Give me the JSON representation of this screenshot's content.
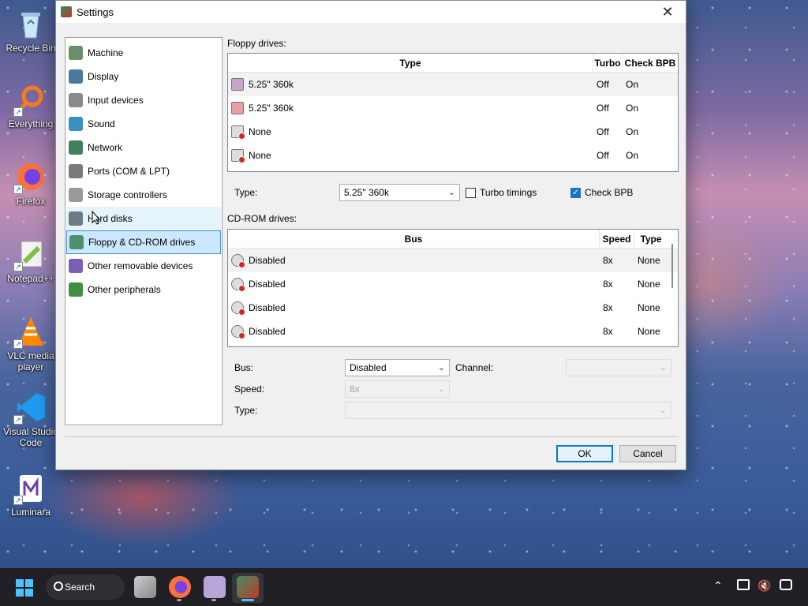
{
  "desktop": {
    "icons": [
      {
        "label": "Recycle Bin",
        "icon": "recycle-bin-icon"
      },
      {
        "label": "Everything",
        "icon": "everything-search-icon"
      },
      {
        "label": "Firefox",
        "icon": "firefox-icon"
      },
      {
        "label": "Notepad++",
        "icon": "notepad-plus-plus-icon"
      },
      {
        "label": "VLC media player",
        "icon": "vlc-icon"
      },
      {
        "label": "Visual Studio Code",
        "icon": "vscode-icon"
      },
      {
        "label": "Luminara",
        "icon": "luminara-icon"
      }
    ]
  },
  "dialog": {
    "title": "Settings",
    "close_glyph": "✕",
    "nav": [
      {
        "label": "Machine",
        "icon": "machine-icon"
      },
      {
        "label": "Display",
        "icon": "display-icon"
      },
      {
        "label": "Input devices",
        "icon": "input-devices-icon"
      },
      {
        "label": "Sound",
        "icon": "sound-icon"
      },
      {
        "label": "Network",
        "icon": "network-icon"
      },
      {
        "label": "Ports (COM & LPT)",
        "icon": "ports-icon"
      },
      {
        "label": "Storage controllers",
        "icon": "storage-controllers-icon"
      },
      {
        "label": "Hard disks",
        "icon": "hard-disks-icon"
      },
      {
        "label": "Floppy & CD-ROM drives",
        "icon": "floppy-cdrom-icon"
      },
      {
        "label": "Other removable devices",
        "icon": "removable-devices-icon"
      },
      {
        "label": "Other peripherals",
        "icon": "peripherals-icon"
      }
    ],
    "hovered_nav": "Hard disks",
    "selected_nav": "Floppy & CD-ROM drives",
    "floppy": {
      "section_label": "Floppy drives:",
      "headers": [
        "Type",
        "Turbo",
        "Check BPB"
      ],
      "rows": [
        {
          "type": "5.25\" 360k",
          "turbo": "Off",
          "check_bpb": "On",
          "enabled": true,
          "selected": true
        },
        {
          "type": "5.25\" 360k",
          "turbo": "Off",
          "check_bpb": "On",
          "enabled": true,
          "selected": false
        },
        {
          "type": "None",
          "turbo": "Off",
          "check_bpb": "On",
          "enabled": false,
          "selected": false
        },
        {
          "type": "None",
          "turbo": "Off",
          "check_bpb": "On",
          "enabled": false,
          "selected": false
        }
      ],
      "type_label": "Type:",
      "type_value": "5.25\" 360k",
      "turbo_label": "Turbo timings",
      "turbo_checked": false,
      "check_bpb_label": "Check BPB",
      "check_bpb_checked": true
    },
    "cdrom": {
      "section_label": "CD-ROM drives:",
      "headers": [
        "Bus",
        "Speed",
        "Type"
      ],
      "rows": [
        {
          "bus": "Disabled",
          "speed": "8x",
          "type": "None",
          "selected": true
        },
        {
          "bus": "Disabled",
          "speed": "8x",
          "type": "None",
          "selected": false
        },
        {
          "bus": "Disabled",
          "speed": "8x",
          "type": "None",
          "selected": false
        },
        {
          "bus": "Disabled",
          "speed": "8x",
          "type": "None",
          "selected": false
        }
      ],
      "bus_label": "Bus:",
      "bus_value": "Disabled",
      "channel_label": "Channel:",
      "channel_value": "",
      "speed_label": "Speed:",
      "speed_value": "8x",
      "type_label": "Type:",
      "type_value": ""
    },
    "ok_label": "OK",
    "cancel_label": "Cancel"
  },
  "taskbar": {
    "search_label": "Search",
    "apps": [
      "file-explorer-icon",
      "firefox-icon",
      "floppy-app-icon",
      "86box-icon"
    ],
    "tray": [
      "chevron-up-icon",
      "network-status-icon",
      "volume-muted-icon",
      "notification-icon"
    ]
  },
  "colors": {
    "accent": "#0078d7",
    "selection": "#cce8ff",
    "taskbar": "#1f1f25",
    "checkbox": "#1a73c9"
  }
}
